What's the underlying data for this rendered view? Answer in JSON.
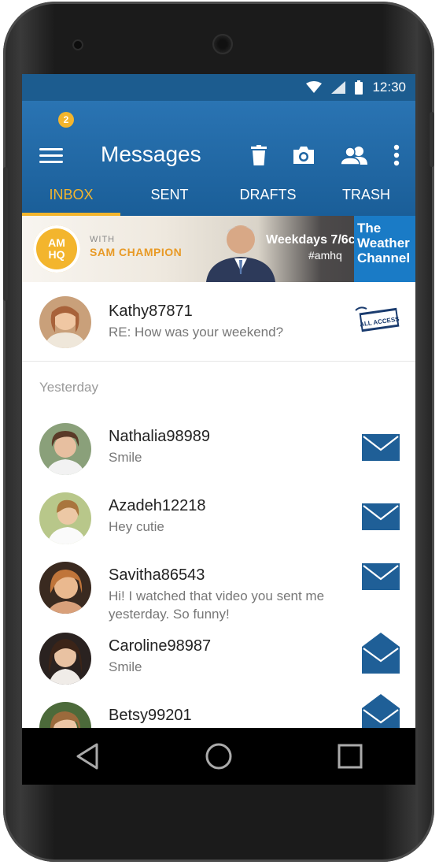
{
  "status_bar": {
    "time": "12:30"
  },
  "app_bar": {
    "title": "Messages",
    "menu_badge": "2",
    "tabs": [
      {
        "label": "INBOX",
        "active": true
      },
      {
        "label": "SENT",
        "active": false
      },
      {
        "label": "DRAFTS",
        "active": false
      },
      {
        "label": "TRASH",
        "active": false
      }
    ],
    "colors": {
      "accent": "#f3b52d",
      "bar": "#2168a8"
    }
  },
  "ad": {
    "logo_top": "AM",
    "logo_bottom": "HQ",
    "with_text": "WITH",
    "host": "SAM CHAMPION",
    "schedule": "Weekdays 7/6c",
    "hashtag": "#amhq",
    "brand_line1": "The",
    "brand_line2": "Weather",
    "brand_line3": "Channel"
  },
  "pinned": {
    "name": "Kathy87871",
    "preview": "RE: How was your weekend?",
    "badge_icon": "all-access-pass-icon",
    "badge_text": "ALL ACCESS"
  },
  "section_label": "Yesterday",
  "messages": [
    {
      "name": "Nathalia98989",
      "preview": "Smile",
      "icon": "envelope-closed-icon"
    },
    {
      "name": "Azadeh12218",
      "preview": "Hey cutie",
      "icon": "envelope-closed-icon"
    },
    {
      "name": "Savitha86543",
      "preview": "Hi! I watched that video you sent me yesterday. So funny!",
      "icon": "envelope-closed-icon"
    },
    {
      "name": "Caroline98987",
      "preview": "Smile",
      "icon": "envelope-open-icon"
    },
    {
      "name": "Betsy99201",
      "preview": "",
      "icon": "envelope-open-icon"
    }
  ]
}
